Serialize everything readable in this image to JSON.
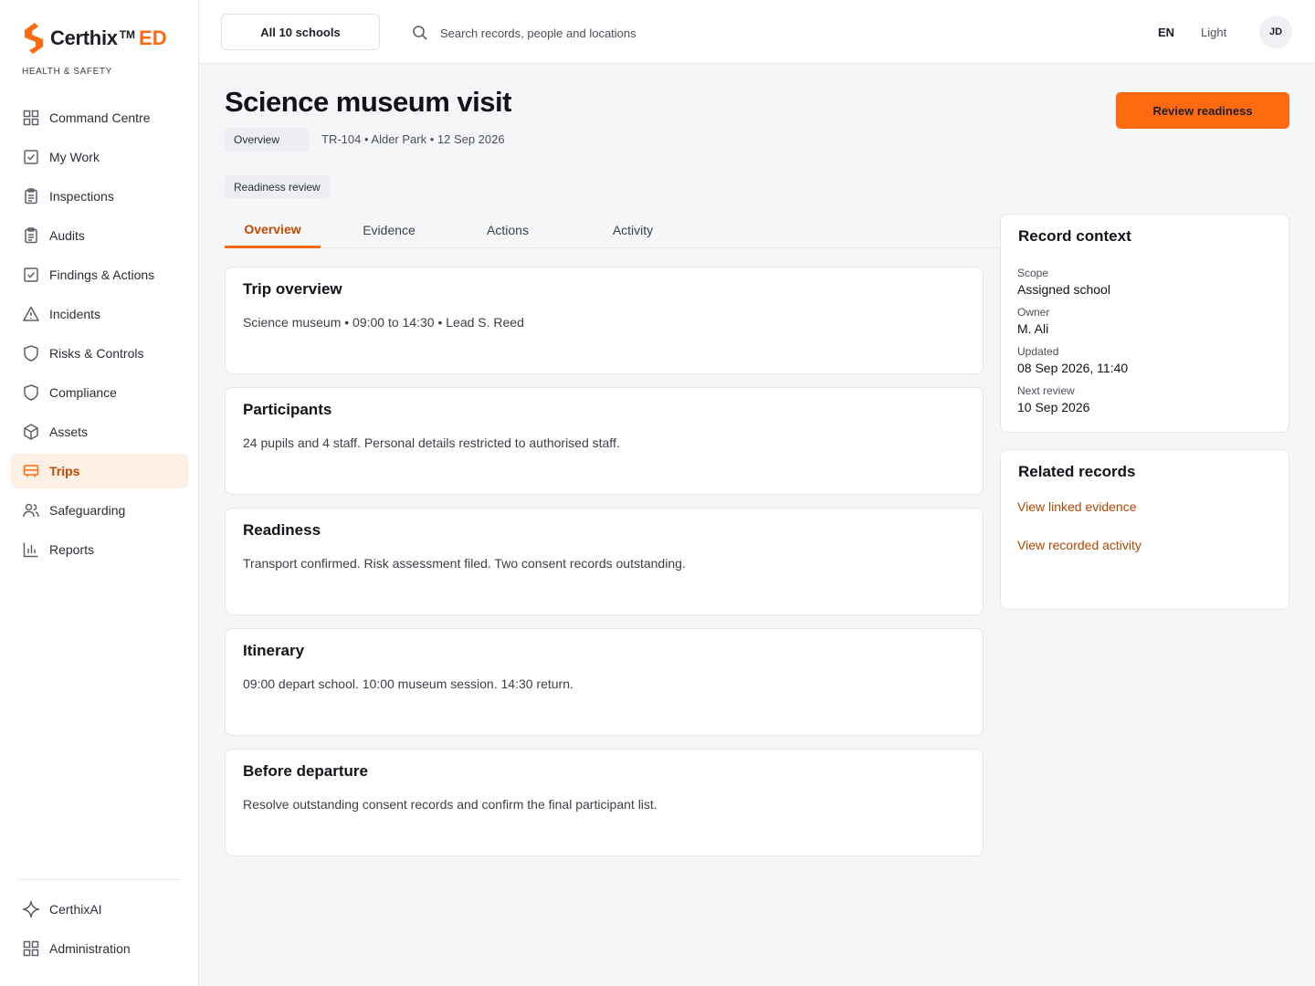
{
  "brand": {
    "name": "Certhix",
    "tm": "TM",
    "suffix": "ED",
    "tagline": "HEALTH & SAFETY",
    "accent_color": "#ff6a10"
  },
  "sidebar": {
    "items": [
      {
        "label": "Command Centre",
        "icon": "grid-icon"
      },
      {
        "label": "My Work",
        "icon": "checkbox-icon"
      },
      {
        "label": "Inspections",
        "icon": "clipboard-icon"
      },
      {
        "label": "Audits",
        "icon": "clipboard-icon"
      },
      {
        "label": "Findings & Actions",
        "icon": "checkbox-icon"
      },
      {
        "label": "Incidents",
        "icon": "warning-icon"
      },
      {
        "label": "Risks & Controls",
        "icon": "shield-icon"
      },
      {
        "label": "Compliance",
        "icon": "shield-icon"
      },
      {
        "label": "Assets",
        "icon": "cube-icon"
      },
      {
        "label": "Trips",
        "icon": "bus-icon",
        "active": true
      },
      {
        "label": "Safeguarding",
        "icon": "users-icon"
      },
      {
        "label": "Reports",
        "icon": "bar-chart-icon"
      }
    ],
    "bottom_items": [
      {
        "label": "CerthixAI",
        "icon": "sparkle-icon"
      },
      {
        "label": "Administration",
        "icon": "grid-icon"
      }
    ]
  },
  "topbar": {
    "school_selector": "All 10 schools",
    "search_placeholder": "Search records, people and locations",
    "language": "EN",
    "theme": "Light",
    "avatar_initials": "JD"
  },
  "page": {
    "title": "Science museum visit",
    "breadcrumb": "Overview",
    "meta": "TR-104 • Alder Park • 12 Sep 2026",
    "status": "Readiness review",
    "primary_action": "Review readiness"
  },
  "tabs": [
    {
      "label": "Overview",
      "active": true
    },
    {
      "label": "Evidence"
    },
    {
      "label": "Actions"
    },
    {
      "label": "Activity"
    }
  ],
  "cards": [
    {
      "title": "Trip overview",
      "body": "Science museum • 09:00 to 14:30 • Lead S. Reed"
    },
    {
      "title": "Participants",
      "body": "24 pupils and 4 staff. Personal details restricted to authorised staff."
    },
    {
      "title": "Readiness",
      "body": "Transport confirmed. Risk assessment filed. Two consent records outstanding."
    },
    {
      "title": "Itinerary",
      "body": "09:00 depart school. 10:00 museum session. 14:30 return."
    },
    {
      "title": "Before departure",
      "body": "Resolve outstanding consent records and confirm the final participant list."
    }
  ],
  "record_context": {
    "title": "Record context",
    "fields": [
      {
        "label": "Scope",
        "value": "Assigned school"
      },
      {
        "label": "Owner",
        "value": "M. Ali"
      },
      {
        "label": "Updated",
        "value": "08 Sep 2026, 11:40"
      },
      {
        "label": "Next review",
        "value": "10 Sep 2026"
      }
    ]
  },
  "related_records": {
    "title": "Related records",
    "links": [
      "View linked evidence",
      "View recorded activity"
    ]
  }
}
